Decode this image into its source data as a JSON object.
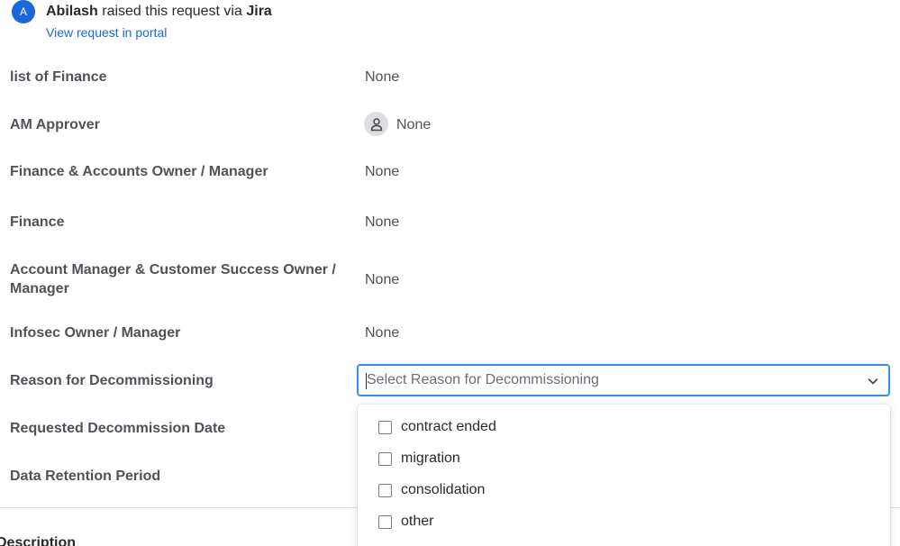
{
  "header": {
    "avatar_initial": "A",
    "requester": "Abilash",
    "raised_text": "raised this request via",
    "channel": "Jira",
    "portal_link": "View request in portal"
  },
  "fields": [
    {
      "label": "list of Finance",
      "value": "None"
    },
    {
      "label": "AM Approver",
      "value": "None"
    },
    {
      "label": "Finance & Accounts Owner / Manager",
      "value": "None"
    },
    {
      "label": "Finance",
      "value": "None"
    },
    {
      "label": "Account Manager & Customer Success Owner / Manager",
      "value": "None"
    },
    {
      "label": "Infosec Owner / Manager",
      "value": "None"
    },
    {
      "label": "Reason for Decommissioning",
      "value": ""
    },
    {
      "label": "Requested Decommission Date",
      "value": ""
    },
    {
      "label": "Data Retention Period",
      "value": ""
    }
  ],
  "reason_select": {
    "placeholder": "Select Reason for Decommissioning",
    "options": [
      "contract ended",
      "migration",
      "consolidation",
      "other"
    ]
  },
  "description_heading": "Description",
  "colors": {
    "link": "#1868db",
    "focus_border": "#388bff",
    "avatar_bg": "#1868db"
  },
  "icons": [
    "user-avatar-icon",
    "chevron-down-icon",
    "checkbox-icon"
  ]
}
